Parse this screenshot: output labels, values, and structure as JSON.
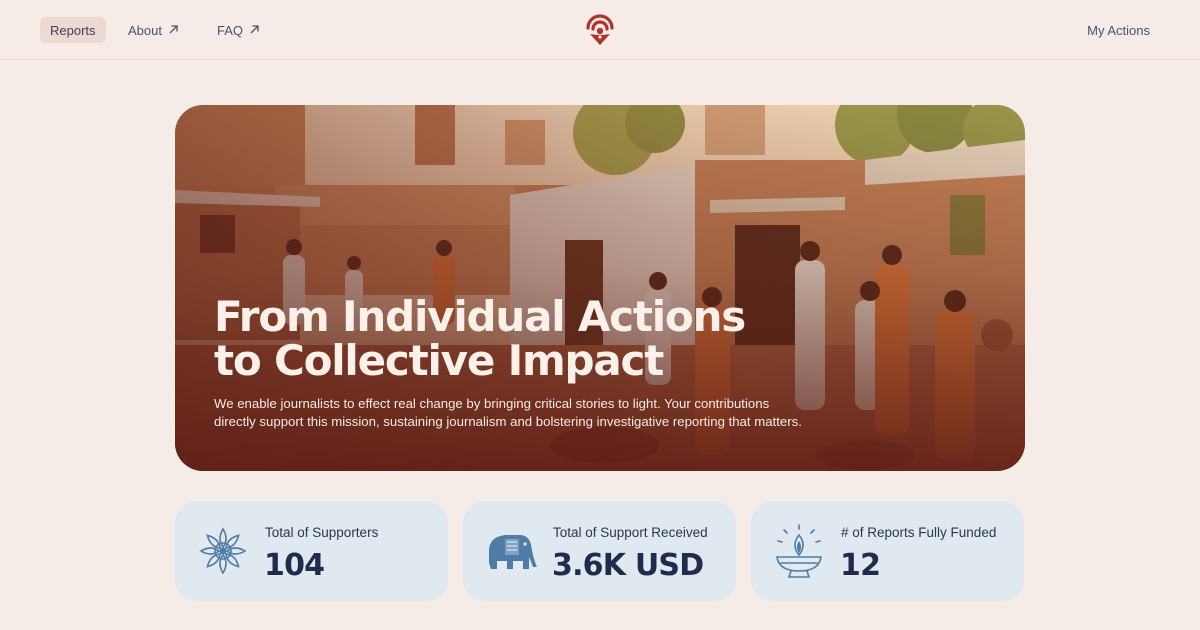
{
  "nav": {
    "reports_label": "Reports",
    "about_label": "About",
    "faq_label": "FAQ",
    "my_actions_label": "My Actions",
    "external_icon": "arrow-up-right-icon"
  },
  "brand": {
    "logo_icon": "signal-pin-logo",
    "accent_color": "#b0342c"
  },
  "hero": {
    "title_line1": "From Individual Actions",
    "title_line2": "to Collective Impact",
    "subtitle_line1": "We enable journalists to effect real change by bringing critical stories to light. Your contributions",
    "subtitle_line2": "directly support this mission, sustaining journalism and bolstering investigative reporting that matters."
  },
  "stats": [
    {
      "label": "Total of Supporters",
      "value": "104",
      "icon": "mandala-flower-icon"
    },
    {
      "label": "Total of Support Received",
      "value": "3.6K USD",
      "icon": "elephant-icon"
    },
    {
      "label": "# of Reports Fully Funded",
      "value": "12",
      "icon": "diya-lamp-icon"
    }
  ],
  "colors": {
    "background": "#f6ece7",
    "card": "#dfe9ef",
    "text_dark": "#232a4e",
    "icon_blue": "#4f7ca6"
  }
}
